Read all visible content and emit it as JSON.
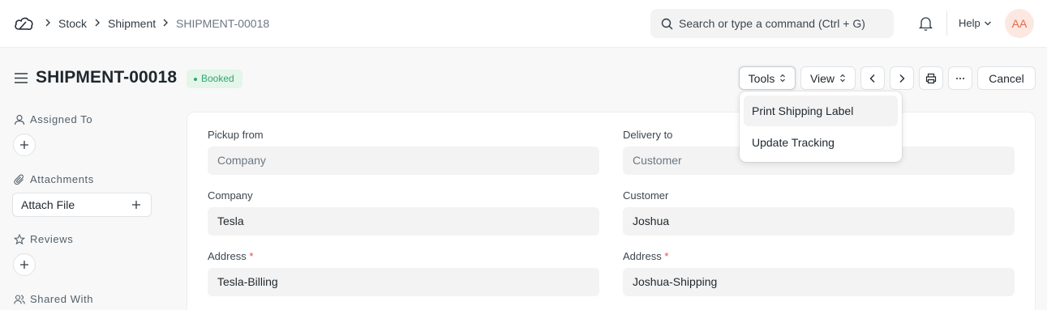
{
  "navbar": {
    "breadcrumbs": [
      "Stock",
      "Shipment",
      "SHIPMENT-00018"
    ],
    "search_placeholder": "Search or type a command (Ctrl + G)",
    "help_label": "Help",
    "avatar_initials": "AA"
  },
  "page": {
    "title": "SHIPMENT-00018",
    "status": "Booked",
    "status_color": "#30a66d"
  },
  "toolbar": {
    "tools_label": "Tools",
    "view_label": "View",
    "cancel_label": "Cancel"
  },
  "tools_menu": {
    "items": [
      "Print Shipping Label",
      "Update Tracking"
    ]
  },
  "sidebar": {
    "assigned_to": "Assigned To",
    "attachments": "Attachments",
    "attach_file": "Attach File",
    "reviews": "Reviews",
    "shared_with": "Shared With"
  },
  "form": {
    "pickup_from": {
      "label": "Pickup from",
      "placeholder": "Company"
    },
    "delivery_to": {
      "label": "Delivery to",
      "placeholder": "Customer"
    },
    "company": {
      "label": "Company",
      "value": "Tesla"
    },
    "customer": {
      "label": "Customer",
      "value": "Joshua"
    },
    "pickup_address": {
      "label": "Address",
      "required_mark": "*",
      "value": "Tesla-Billing"
    },
    "delivery_address": {
      "label": "Address",
      "required_mark": "*",
      "value": "Joshua-Shipping"
    }
  }
}
